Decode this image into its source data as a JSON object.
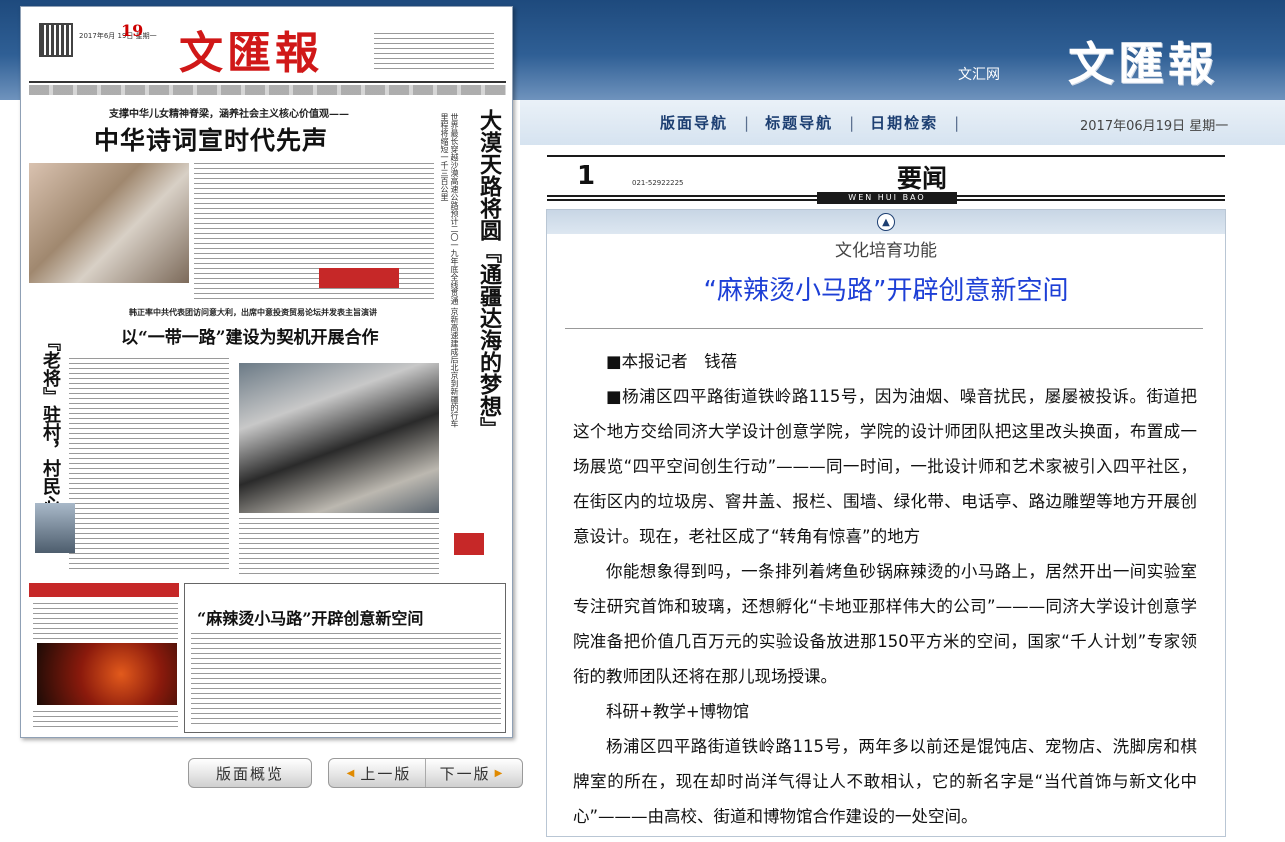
{
  "site": {
    "name": "文汇网",
    "logo": "文匯報"
  },
  "nav": {
    "items": [
      "版面导航",
      "标题导航",
      "日期检索"
    ],
    "date": "2017年06月19日 星期一"
  },
  "paper_preview": {
    "logo": "文匯報",
    "issue": "19",
    "date_line": "2017年6月 19日 星期一",
    "subhead_1": "支撑中华儿女精神脊梁，涵养社会主义核心价值观——",
    "headline_1": "中华诗词宣时代先声",
    "vertical_headline": "大漠天路将圆『通疆达海的梦想』",
    "vertical_sub": "世界最长穿越沙漠高速公路预计二〇一九年底全线贯通 京新高速建成后北京到新疆的行车里程将缩短一千三百公里",
    "subhead_2": "韩正率中共代表团访问意大利，出席中意投资贸易论坛并发表主旨演讲",
    "headline_2": "以“一带一路”建设为契机开展合作",
    "vertical_headline_2": "『老将』驻村，村民心安",
    "headline_3": "“麻辣烫小马路”开辟创意新空间"
  },
  "buttons": {
    "overview": "版面概览",
    "prev": "上一版",
    "next": "下一版"
  },
  "page": {
    "number": "1",
    "phone": "021-52922225",
    "title": "要闻",
    "band_label": "WEN HUI BAO"
  },
  "article": {
    "kicker": "文化培育功能",
    "headline": "“麻辣烫小马路”开辟创意新空间",
    "paragraphs": [
      "■本报记者　钱蓓",
      "■杨浦区四平路街道铁岭路115号，因为油烟、噪音扰民，屡屡被投诉。街道把这个地方交给同济大学设计创意学院，学院的设计师团队把这里改头换面，布置成一场展览“四平空间创生行动”———同一时间，一批设计师和艺术家被引入四平社区，在街区内的垃圾房、窨井盖、报栏、围墙、绿化带、电话亭、路边雕塑等地方开展创意设计。现在，老社区成了“转角有惊喜”的地方",
      "你能想象得到吗，一条排列着烤鱼砂锅麻辣烫的小马路上，居然开出一间实验室专注研究首饰和玻璃，还想孵化“卡地亚那样伟大的公司”———同济大学设计创意学院准备把价值几百万元的实验设备放进那150平方米的空间，国家“千人计划”专家领衔的教师团队还将在那儿现场授课。",
      "科研+教学+博物馆",
      "杨浦区四平路街道铁岭路115号，两年多以前还是馄饨店、宠物店、洗脚房和棋牌室的所在，现在却时尚洋气得让人不敢相认，它的新名字是“当代首饰与新文化中心”———由高校、街道和博物馆合作建设的一处空间。"
    ]
  },
  "colors": {
    "header_blue": "#1e4a7d",
    "headline_blue": "#1d3fd6",
    "paper_red": "#d01818"
  },
  "icons": {
    "collapse": "chevron-up-icon",
    "prev": "triangle-left-icon",
    "next": "triangle-right-icon"
  }
}
